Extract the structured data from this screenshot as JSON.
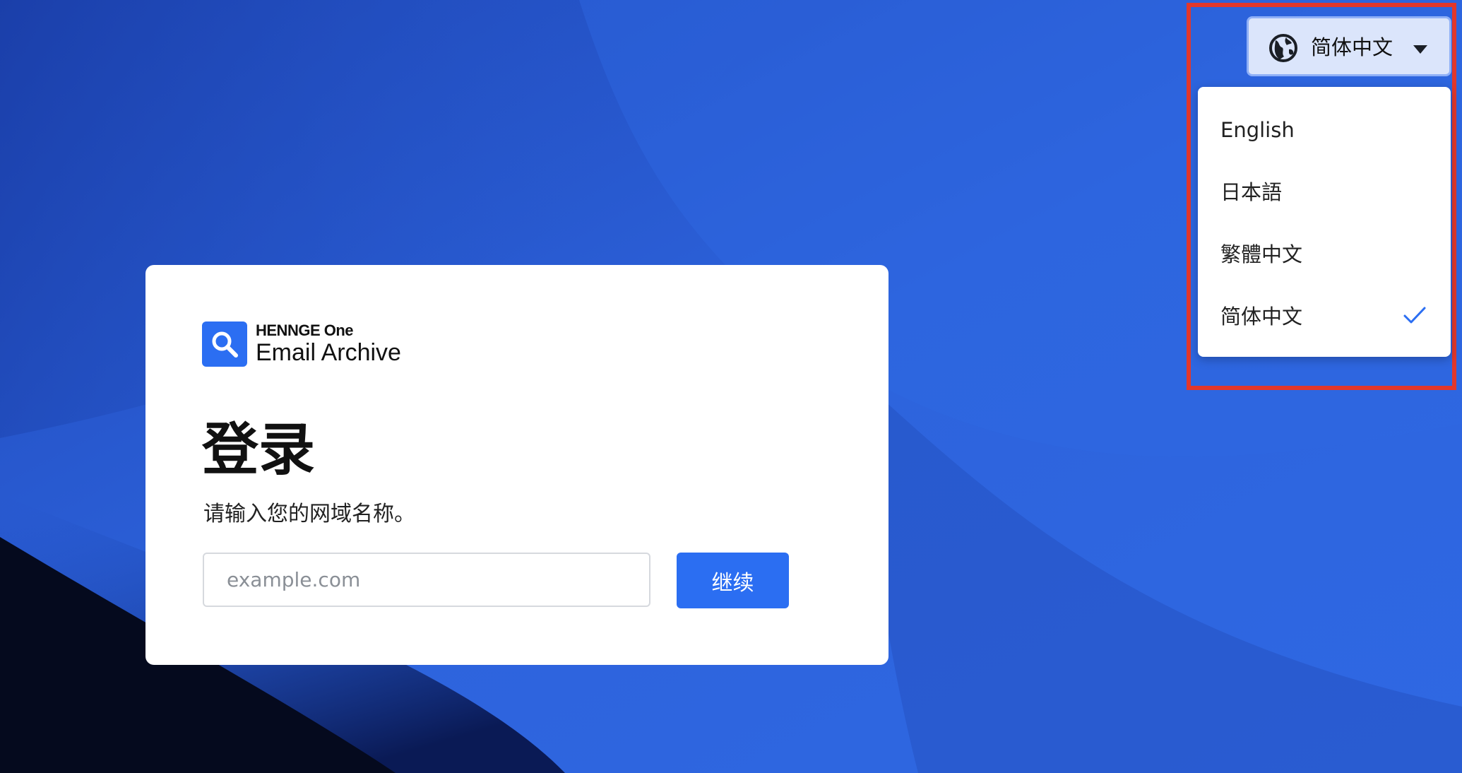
{
  "colors": {
    "background": "#2a5fd6",
    "accent": "#2b6ef2",
    "highlight_border": "#e2372b",
    "check": "#2b6ef2"
  },
  "logo": {
    "brand": "HENNGE One",
    "product": "Email Archive",
    "icon": "magnifier-icon"
  },
  "login": {
    "title": "登录",
    "subtitle": "请输入您的网域名称。",
    "domain_placeholder": "example.com",
    "continue_label": "继续"
  },
  "language_selector": {
    "current_label": "简体中文",
    "globe_icon": "globe-icon",
    "dropdown_icon": "chevron-down-icon",
    "options": [
      {
        "label": "English",
        "selected": false
      },
      {
        "label": "日本語",
        "selected": false
      },
      {
        "label": "繁體中文",
        "selected": false
      },
      {
        "label": "简体中文",
        "selected": true
      }
    ]
  }
}
